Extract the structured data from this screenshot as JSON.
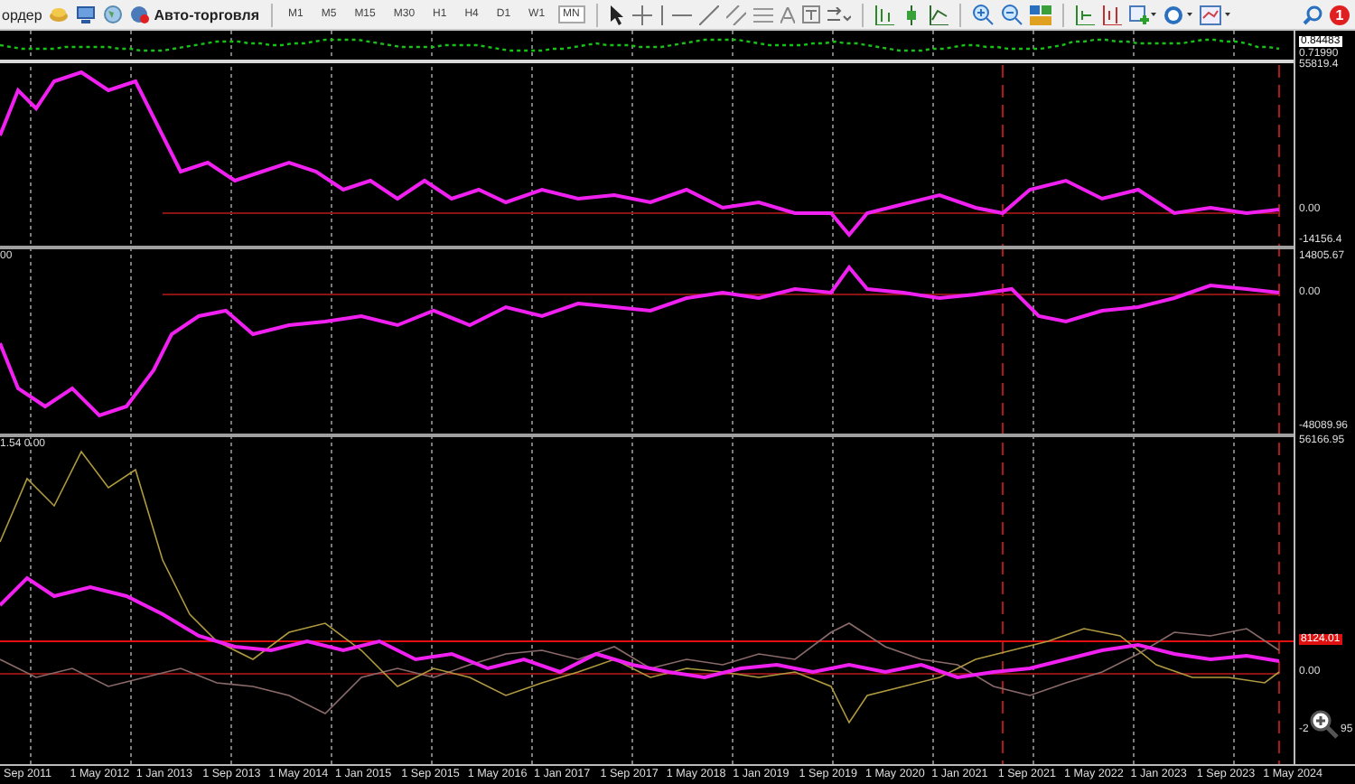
{
  "toolbar": {
    "order_label": "ордер",
    "autotrading_label": "Авто-торговля",
    "timeframes": [
      {
        "label": "M1",
        "selected": false
      },
      {
        "label": "M5",
        "selected": false
      },
      {
        "label": "M15",
        "selected": false
      },
      {
        "label": "M30",
        "selected": false
      },
      {
        "label": "H1",
        "selected": false
      },
      {
        "label": "H4",
        "selected": false
      },
      {
        "label": "D1",
        "selected": false
      },
      {
        "label": "W1",
        "selected": false
      },
      {
        "label": "MN",
        "selected": true
      }
    ],
    "notification_count": "1"
  },
  "panes": [
    {
      "scale": [
        {
          "text": "0.84483",
          "kind": "current"
        },
        {
          "text": "0.71990",
          "kind": "plain"
        }
      ]
    },
    {
      "scale": [
        {
          "text": "55819.4",
          "kind": "plain"
        },
        {
          "text": "0.00",
          "kind": "plain"
        },
        {
          "text": "-14156.4",
          "kind": "plain"
        }
      ]
    },
    {
      "corner_label": "00",
      "scale": [
        {
          "text": "14805.67",
          "kind": "plain"
        },
        {
          "text": "0.00",
          "kind": "plain"
        },
        {
          "text": "-48089.96",
          "kind": "plain"
        }
      ]
    },
    {
      "corner_label": "1.54 0.00",
      "scale": [
        {
          "text": "56166.95",
          "kind": "plain"
        },
        {
          "text": "8124.01",
          "kind": "level"
        },
        {
          "text": "0.00",
          "kind": "plain"
        },
        {
          "text": "-2",
          "kind": "plain"
        },
        {
          "text": "95",
          "kind": "plain"
        }
      ]
    }
  ],
  "time_axis": [
    "Sep 2011",
    "1 May 2012",
    "1 Jan 2013",
    "1 Sep 2013",
    "1 May 2014",
    "1 Jan 2015",
    "1 Sep 2015",
    "1 May 2016",
    "1 Jan 2017",
    "1 Sep 2017",
    "1 May 2018",
    "1 Jan 2019",
    "1 Sep 2019",
    "1 May 2020",
    "1 Jan 2021",
    "1 Sep 2021",
    "1 May 2022",
    "1 Jan 2023",
    "1 Sep 2023",
    "1 May 2024"
  ]
}
